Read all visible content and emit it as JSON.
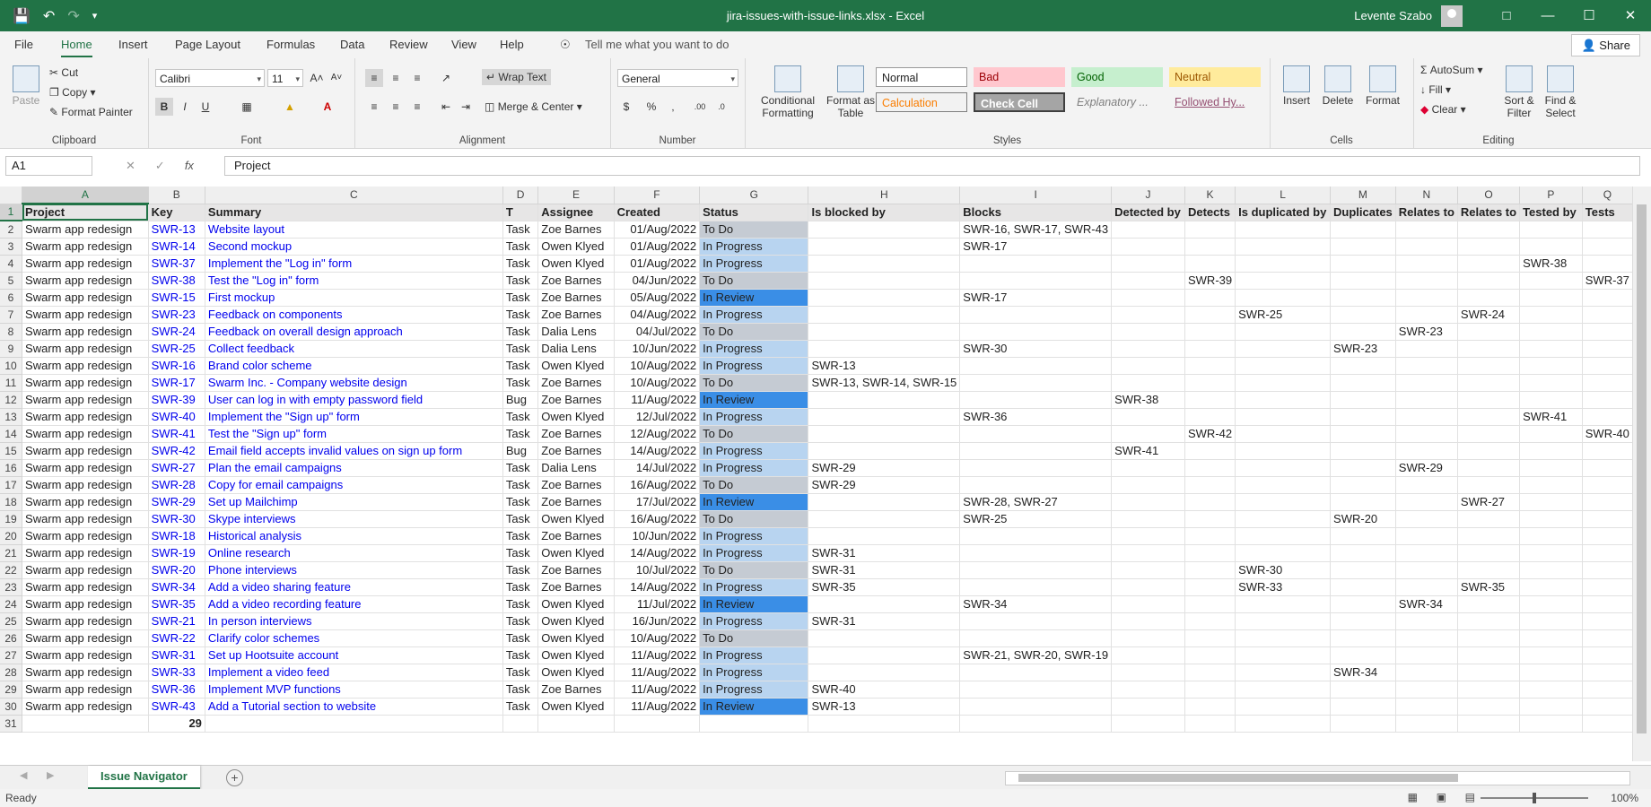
{
  "window": {
    "title": "jira-issues-with-issue-links.xlsx  -  Excel",
    "user": "Levente Szabo",
    "accent": "#217346"
  },
  "menu": {
    "tabs": [
      "File",
      "Home",
      "Insert",
      "Page Layout",
      "Formulas",
      "Data",
      "Review",
      "View",
      "Help"
    ],
    "active": "Home",
    "tell_me": "Tell me what you want to do",
    "share": "Share"
  },
  "ribbon": {
    "clipboard": {
      "label": "Clipboard",
      "paste": "Paste",
      "cut": "Cut",
      "copy": "Copy",
      "format_painter": "Format Painter"
    },
    "font": {
      "label": "Font",
      "name": "Calibri",
      "size": "11"
    },
    "alignment": {
      "label": "Alignment",
      "wrap": "Wrap Text",
      "merge": "Merge & Center"
    },
    "number": {
      "label": "Number",
      "format": "General"
    },
    "styles": {
      "label": "Styles",
      "conditional": "Conditional Formatting",
      "format_table": "Format as Table",
      "cells": [
        "Normal",
        "Bad",
        "Good",
        "Neutral",
        "Calculation",
        "Check Cell",
        "Explanatory ...",
        "Followed Hy..."
      ]
    },
    "cells": {
      "label": "Cells",
      "insert": "Insert",
      "delete": "Delete",
      "format": "Format"
    },
    "editing": {
      "label": "Editing",
      "autosum": "AutoSum",
      "fill": "Fill",
      "clear": "Clear",
      "sort": "Sort & Filter",
      "find": "Find & Select"
    }
  },
  "formula_bar": {
    "cell": "A1",
    "value": "Project"
  },
  "sheet": {
    "columns": [
      "A",
      "B",
      "C",
      "D",
      "E",
      "F",
      "G",
      "H",
      "I",
      "J",
      "K",
      "L",
      "M",
      "N",
      "O",
      "P",
      "Q"
    ],
    "headers": [
      "Project",
      "Key",
      "Summary",
      "T",
      "Assignee",
      "Created",
      "Status",
      "Is blocked by",
      "Blocks",
      "Detected by",
      "Detects",
      "Is duplicated by",
      "Duplicates",
      "Relates to",
      "Relates to",
      "Tested by",
      "Tests"
    ],
    "rows": [
      [
        "Swarm app redesign",
        "SWR-13",
        "Website layout",
        "Task",
        "Zoe Barnes",
        "01/Aug/2022",
        "To Do",
        "",
        "SWR-16, SWR-17, SWR-43",
        "",
        "",
        "",
        "",
        "",
        "",
        "",
        ""
      ],
      [
        "Swarm app redesign",
        "SWR-14",
        "Second mockup",
        "Task",
        "Owen Klyed",
        "01/Aug/2022",
        "In Progress",
        "",
        "SWR-17",
        "",
        "",
        "",
        "",
        "",
        "",
        "",
        ""
      ],
      [
        "Swarm app redesign",
        "SWR-37",
        "Implement the \"Log in\" form",
        "Task",
        "Owen Klyed",
        "01/Aug/2022",
        "In Progress",
        "",
        "",
        "",
        "",
        "",
        "",
        "",
        "",
        "SWR-38",
        ""
      ],
      [
        "Swarm app redesign",
        "SWR-38",
        "Test the \"Log in\" form",
        "Task",
        "Zoe Barnes",
        "04/Jun/2022",
        "To Do",
        "",
        "",
        "",
        "SWR-39",
        "",
        "",
        "",
        "",
        "",
        "SWR-37"
      ],
      [
        "Swarm app redesign",
        "SWR-15",
        "First mockup",
        "Task",
        "Zoe Barnes",
        "05/Aug/2022",
        "In Review",
        "",
        "SWR-17",
        "",
        "",
        "",
        "",
        "",
        "",
        "",
        ""
      ],
      [
        "Swarm app redesign",
        "SWR-23",
        "Feedback on components",
        "Task",
        "Zoe Barnes",
        "04/Aug/2022",
        "In Progress",
        "",
        "",
        "",
        "",
        "SWR-25",
        "",
        "",
        "SWR-24",
        "",
        ""
      ],
      [
        "Swarm app redesign",
        "SWR-24",
        "Feedback on overall design approach",
        "Task",
        "Dalia Lens",
        "04/Jul/2022",
        "To Do",
        "",
        "",
        "",
        "",
        "",
        "",
        "SWR-23",
        "",
        "",
        ""
      ],
      [
        "Swarm app redesign",
        "SWR-25",
        "Collect feedback",
        "Task",
        "Dalia Lens",
        "10/Jun/2022",
        "In Progress",
        "",
        "SWR-30",
        "",
        "",
        "",
        "SWR-23",
        "",
        "",
        "",
        ""
      ],
      [
        "Swarm app redesign",
        "SWR-16",
        "Brand color scheme",
        "Task",
        "Owen Klyed",
        "10/Aug/2022",
        "In Progress",
        "SWR-13",
        "",
        "",
        "",
        "",
        "",
        "",
        "",
        "",
        ""
      ],
      [
        "Swarm app redesign",
        "SWR-17",
        "Swarm Inc. - Company website design",
        "Task",
        "Zoe Barnes",
        "10/Aug/2022",
        "To Do",
        "SWR-13, SWR-14, SWR-15",
        "",
        "",
        "",
        "",
        "",
        "",
        "",
        "",
        ""
      ],
      [
        "Swarm app redesign",
        "SWR-39",
        "User can log in with empty password field",
        "Bug",
        "Zoe Barnes",
        "11/Aug/2022",
        "In Review",
        "",
        "",
        "SWR-38",
        "",
        "",
        "",
        "",
        "",
        "",
        ""
      ],
      [
        "Swarm app redesign",
        "SWR-40",
        "Implement the \"Sign up\" form",
        "Task",
        "Owen Klyed",
        "12/Jul/2022",
        "In Progress",
        "",
        "SWR-36",
        "",
        "",
        "",
        "",
        "",
        "",
        "SWR-41",
        ""
      ],
      [
        "Swarm app redesign",
        "SWR-41",
        "Test the \"Sign up\" form",
        "Task",
        "Zoe Barnes",
        "12/Aug/2022",
        "To Do",
        "",
        "",
        "",
        "SWR-42",
        "",
        "",
        "",
        "",
        "",
        "SWR-40"
      ],
      [
        "Swarm app redesign",
        "SWR-42",
        "Email field accepts invalid values on sign up form",
        "Bug",
        "Zoe Barnes",
        "14/Aug/2022",
        "In Progress",
        "",
        "",
        "SWR-41",
        "",
        "",
        "",
        "",
        "",
        "",
        ""
      ],
      [
        "Swarm app redesign",
        "SWR-27",
        "Plan the email campaigns",
        "Task",
        "Dalia Lens",
        "14/Jul/2022",
        "In Progress",
        "SWR-29",
        "",
        "",
        "",
        "",
        "",
        "SWR-29",
        "",
        "",
        ""
      ],
      [
        "Swarm app redesign",
        "SWR-28",
        "Copy for email campaigns",
        "Task",
        "Zoe Barnes",
        "16/Aug/2022",
        "To Do",
        "SWR-29",
        "",
        "",
        "",
        "",
        "",
        "",
        "",
        "",
        ""
      ],
      [
        "Swarm app redesign",
        "SWR-29",
        "Set up Mailchimp",
        "Task",
        "Zoe Barnes",
        "17/Jul/2022",
        "In Review",
        "",
        "SWR-28, SWR-27",
        "",
        "",
        "",
        "",
        "",
        "SWR-27",
        "",
        ""
      ],
      [
        "Swarm app redesign",
        "SWR-30",
        "Skype interviews",
        "Task",
        "Owen Klyed",
        "16/Aug/2022",
        "To Do",
        "",
        "SWR-25",
        "",
        "",
        "",
        "SWR-20",
        "",
        "",
        "",
        ""
      ],
      [
        "Swarm app redesign",
        "SWR-18",
        "Historical analysis",
        "Task",
        "Zoe Barnes",
        "10/Jun/2022",
        "In Progress",
        "",
        "",
        "",
        "",
        "",
        "",
        "",
        "",
        "",
        ""
      ],
      [
        "Swarm app redesign",
        "SWR-19",
        "Online research",
        "Task",
        "Owen Klyed",
        "14/Aug/2022",
        "In Progress",
        "SWR-31",
        "",
        "",
        "",
        "",
        "",
        "",
        "",
        "",
        ""
      ],
      [
        "Swarm app redesign",
        "SWR-20",
        "Phone interviews",
        "Task",
        "Zoe Barnes",
        "10/Jul/2022",
        "To Do",
        "SWR-31",
        "",
        "",
        "",
        "SWR-30",
        "",
        "",
        "",
        "",
        ""
      ],
      [
        "Swarm app redesign",
        "SWR-34",
        "Add a video sharing feature",
        "Task",
        "Zoe Barnes",
        "14/Aug/2022",
        "In Progress",
        "SWR-35",
        "",
        "",
        "",
        "SWR-33",
        "",
        "",
        "SWR-35",
        "",
        ""
      ],
      [
        "Swarm app redesign",
        "SWR-35",
        "Add a video recording feature",
        "Task",
        "Owen Klyed",
        "11/Jul/2022",
        "In Review",
        "",
        "SWR-34",
        "",
        "",
        "",
        "",
        "SWR-34",
        "",
        "",
        ""
      ],
      [
        "Swarm app redesign",
        "SWR-21",
        "In person interviews",
        "Task",
        "Owen Klyed",
        "16/Jun/2022",
        "In Progress",
        "SWR-31",
        "",
        "",
        "",
        "",
        "",
        "",
        "",
        "",
        ""
      ],
      [
        "Swarm app redesign",
        "SWR-22",
        "Clarify color schemes",
        "Task",
        "Owen Klyed",
        "10/Aug/2022",
        "To Do",
        "",
        "",
        "",
        "",
        "",
        "",
        "",
        "",
        "",
        ""
      ],
      [
        "Swarm app redesign",
        "SWR-31",
        "Set up Hootsuite account",
        "Task",
        "Owen Klyed",
        "11/Aug/2022",
        "In Progress",
        "",
        "SWR-21, SWR-20, SWR-19",
        "",
        "",
        "",
        "",
        "",
        "",
        "",
        ""
      ],
      [
        "Swarm app redesign",
        "SWR-33",
        "Implement a video feed",
        "Task",
        "Owen Klyed",
        "11/Aug/2022",
        "In Progress",
        "",
        "",
        "",
        "",
        "",
        "SWR-34",
        "",
        "",
        "",
        ""
      ],
      [
        "Swarm app redesign",
        "SWR-36",
        "Implement MVP functions",
        "Task",
        "Zoe Barnes",
        "11/Aug/2022",
        "In Progress",
        "SWR-40",
        "",
        "",
        "",
        "",
        "",
        "",
        "",
        "",
        ""
      ],
      [
        "Swarm app redesign",
        "SWR-43",
        "Add a Tutorial section to website",
        "Task",
        "Owen Klyed",
        "11/Aug/2022",
        "In Review",
        "SWR-13",
        "",
        "",
        "",
        "",
        "",
        "",
        "",
        "",
        ""
      ]
    ],
    "total": "29",
    "status_colors": {
      "To Do": "#c5cbd3",
      "In Progress": "#b8d4f0",
      "In Review": "#3a8ee6"
    }
  },
  "sheet_tabs": [
    "Issue Navigator"
  ],
  "status": {
    "ready": "Ready",
    "zoom": "100%"
  }
}
